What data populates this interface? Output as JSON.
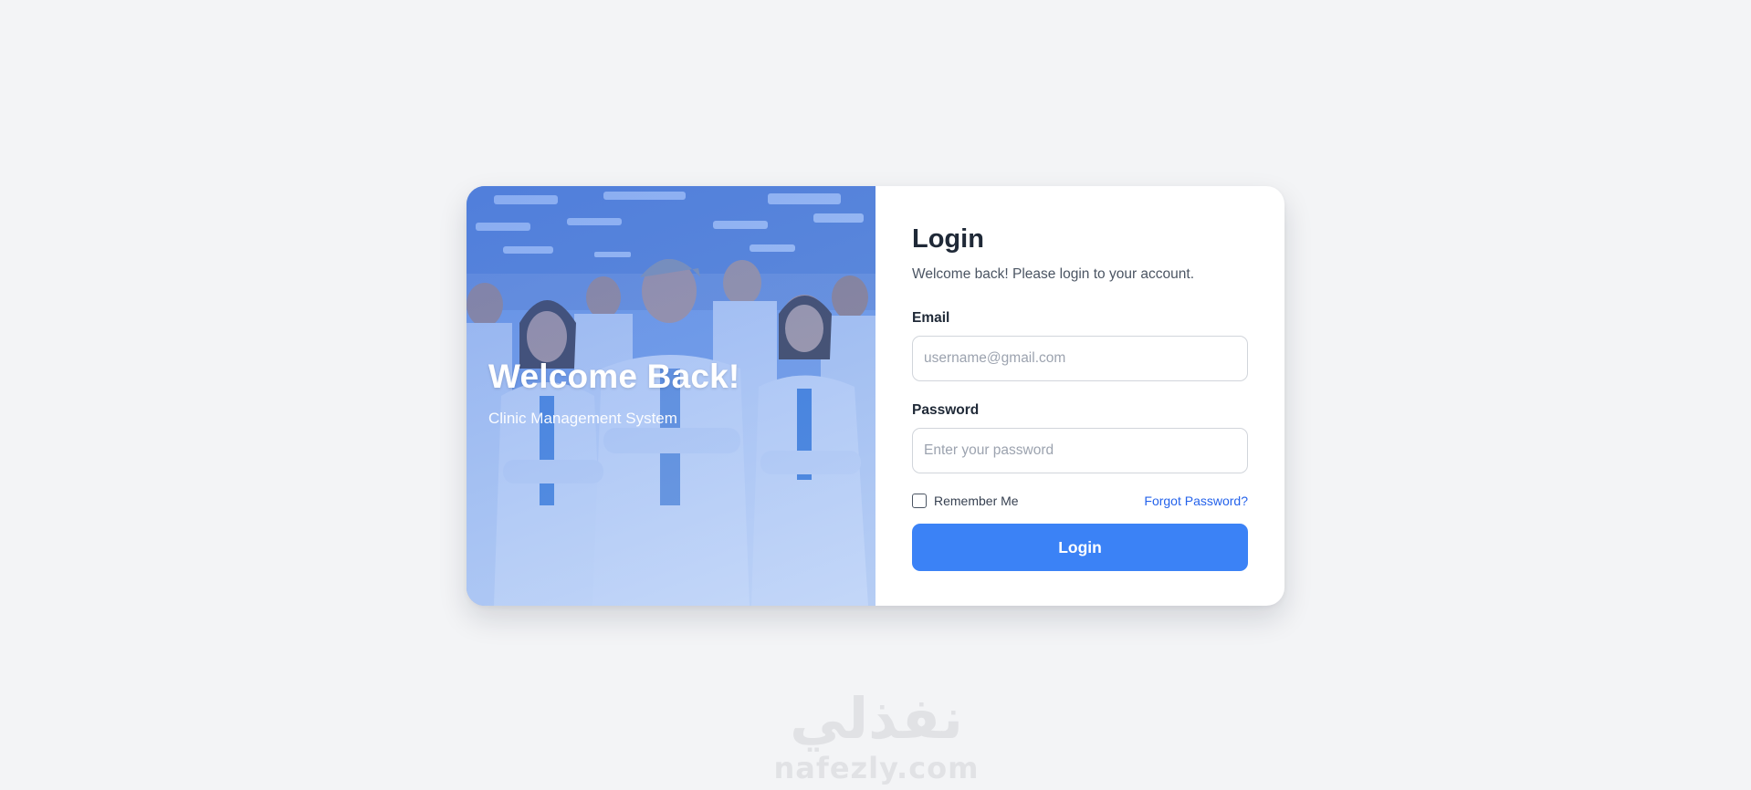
{
  "hero": {
    "title": "Welcome Back!",
    "subtitle": "Clinic Management System",
    "image": "group-of-doctors-photo"
  },
  "login_form": {
    "title": "Login",
    "subtitle": "Welcome back! Please login to your account.",
    "email": {
      "label": "Email",
      "value": "",
      "placeholder": "username@gmail.com"
    },
    "password": {
      "label": "Password",
      "value": "",
      "placeholder": "Enter your password"
    },
    "remember_me": {
      "label": "Remember Me",
      "checked": false
    },
    "forgot_password_label": "Forgot Password?",
    "submit_label": "Login"
  },
  "watermark": {
    "arabic": "نفذلي",
    "latin": "nafezly.com"
  },
  "colors": {
    "page_background": "#f3f4f6",
    "primary": "#3b82f6",
    "link": "#2563eb",
    "heading": "#1f2937",
    "hero_overlay": "#4f86e8"
  }
}
